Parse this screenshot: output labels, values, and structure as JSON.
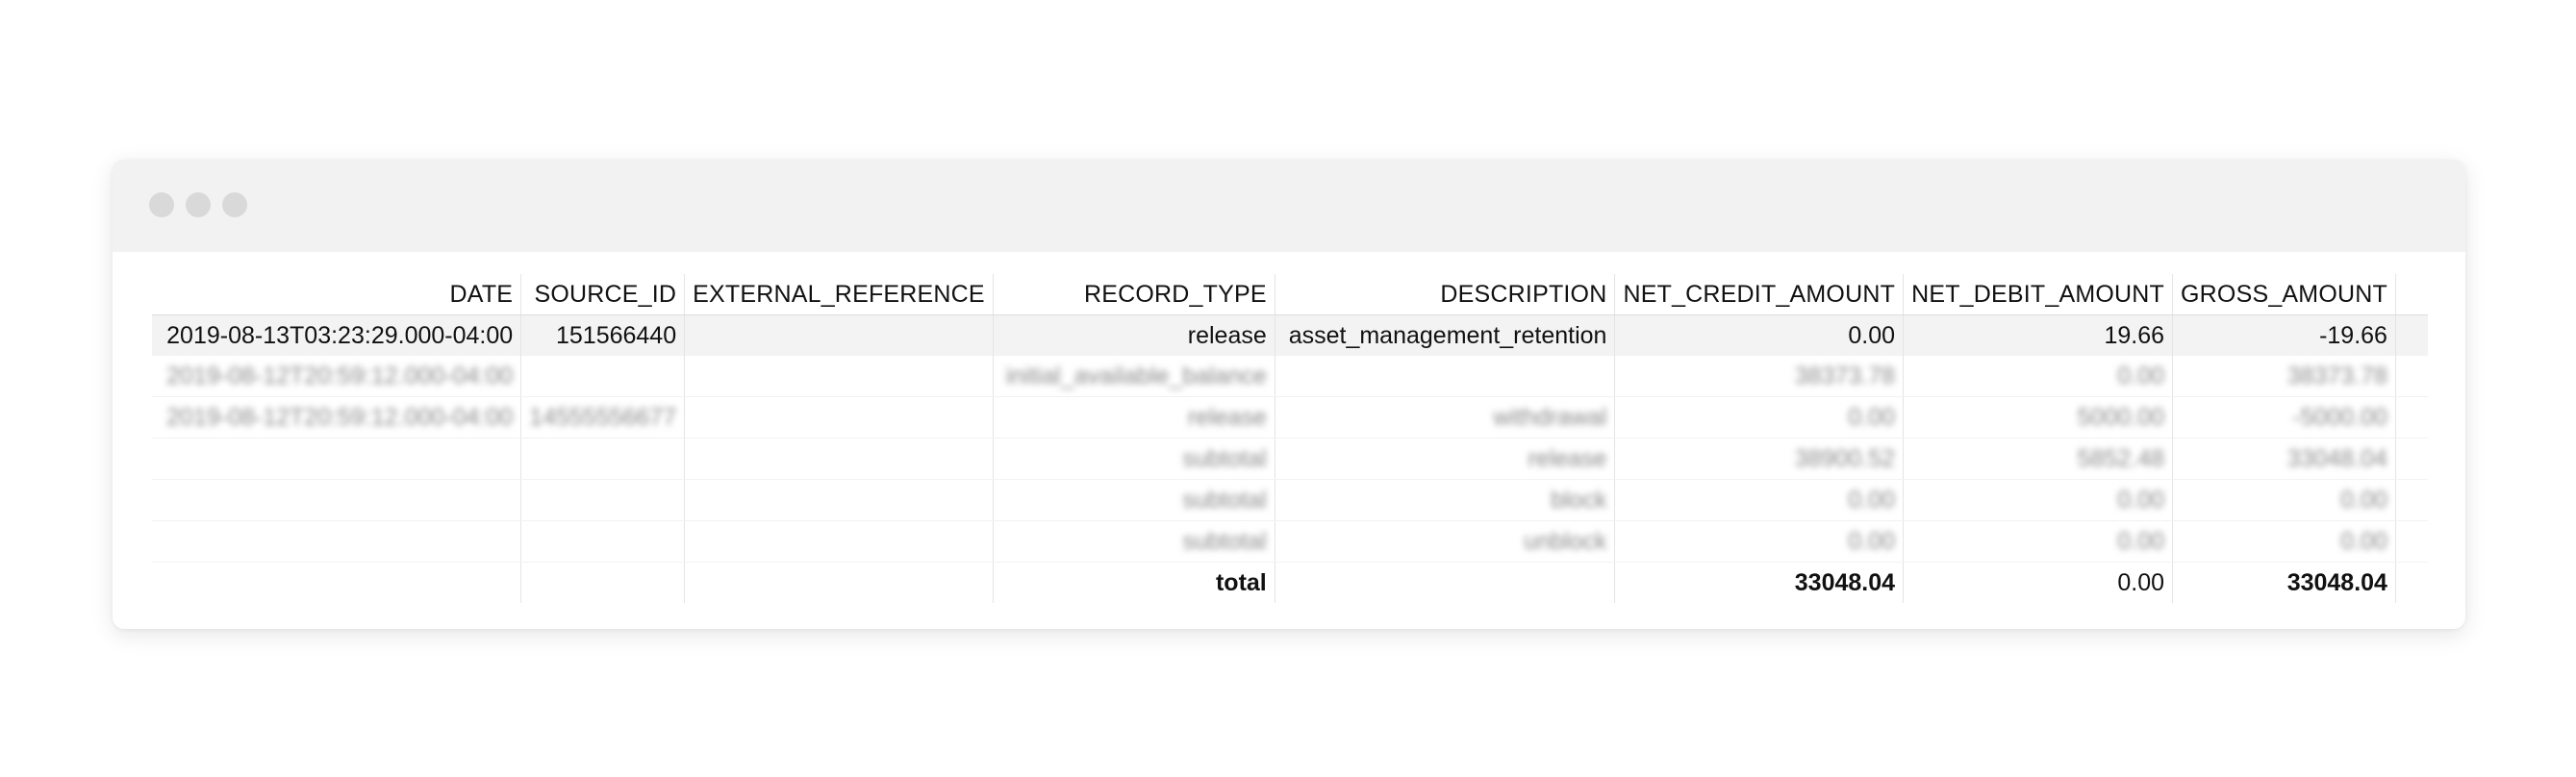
{
  "window": {
    "controls": [
      "close",
      "minimize",
      "maximize"
    ]
  },
  "table": {
    "headers": {
      "date": "DATE",
      "source_id": "SOURCE_ID",
      "external_reference": "EXTERNAL_REFERENCE",
      "record_type": "RECORD_TYPE",
      "description": "DESCRIPTION",
      "net_credit_amount": "NET_CREDIT_AMOUNT",
      "net_debit_amount": "NET_DEBIT_AMOUNT",
      "gross_amount": "GROSS_AMOUNT"
    },
    "rows": [
      {
        "date": "2019-08-13T03:23:29.000-04:00",
        "source_id": "151566440",
        "external_reference": "",
        "record_type": "release",
        "description": "asset_management_retention",
        "net_credit_amount": "0.00",
        "net_debit_amount": "19.66",
        "gross_amount": "-19.66"
      },
      {
        "date": "2019-08-12T20:59:12.000-04:00",
        "source_id": "",
        "external_reference": "",
        "record_type": "initial_available_balance",
        "description": "",
        "net_credit_amount": "38373.78",
        "net_debit_amount": "0.00",
        "gross_amount": "38373.78"
      },
      {
        "date": "2019-08-12T20:59:12.000-04:00",
        "source_id": "14555556677",
        "external_reference": "",
        "record_type": "release",
        "description": "withdrawal",
        "net_credit_amount": "0.00",
        "net_debit_amount": "5000.00",
        "gross_amount": "-5000.00"
      },
      {
        "date": "",
        "source_id": "",
        "external_reference": "",
        "record_type": "subtotal",
        "description": "release",
        "net_credit_amount": "38900.52",
        "net_debit_amount": "5852.48",
        "gross_amount": "33048.04"
      },
      {
        "date": "",
        "source_id": "",
        "external_reference": "",
        "record_type": "subtotal",
        "description": "block",
        "net_credit_amount": "0.00",
        "net_debit_amount": "0.00",
        "gross_amount": "0.00"
      },
      {
        "date": "",
        "source_id": "",
        "external_reference": "",
        "record_type": "subtotal",
        "description": "unblock",
        "net_credit_amount": "0.00",
        "net_debit_amount": "0.00",
        "gross_amount": "0.00"
      }
    ],
    "total": {
      "record_type": "total",
      "net_credit_amount": "33048.04",
      "net_debit_amount": "0.00",
      "gross_amount": "33048.04"
    }
  }
}
